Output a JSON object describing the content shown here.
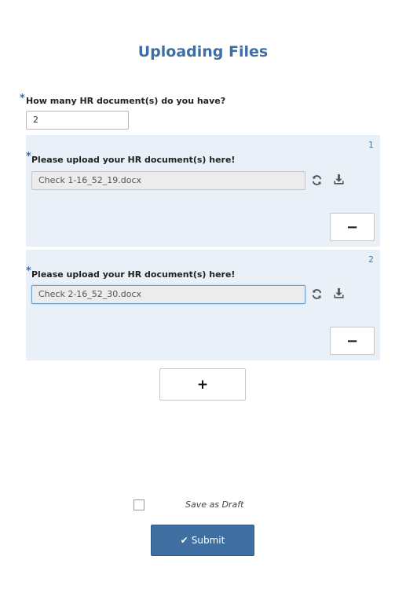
{
  "form": {
    "title": "Uploading Files",
    "required_mark": "*",
    "count_question": {
      "label": "How many HR document(s) do you have?",
      "value": "2"
    },
    "upload_blocks": [
      {
        "index": "1",
        "label": "Please upload your HR document(s) here!",
        "file_name": "Check 1-16_52_19.docx",
        "remove_label": "−",
        "refresh_icon": "refresh-icon",
        "download_icon": "download-icon"
      },
      {
        "index": "2",
        "label": "Please upload your HR document(s) here!",
        "file_name": "Check 2-16_52_30.docx",
        "remove_label": "−",
        "refresh_icon": "refresh-icon",
        "download_icon": "download-icon"
      }
    ],
    "add_label": "+",
    "save_as_draft": {
      "label": "Save as Draft",
      "checked": false
    },
    "submit": {
      "icon": "check-icon",
      "glyph": "✔",
      "label": "Submit"
    }
  },
  "colors": {
    "accent": "#3f6fa1",
    "block_background": "#e9f0f7",
    "field_background": "#ececec"
  }
}
